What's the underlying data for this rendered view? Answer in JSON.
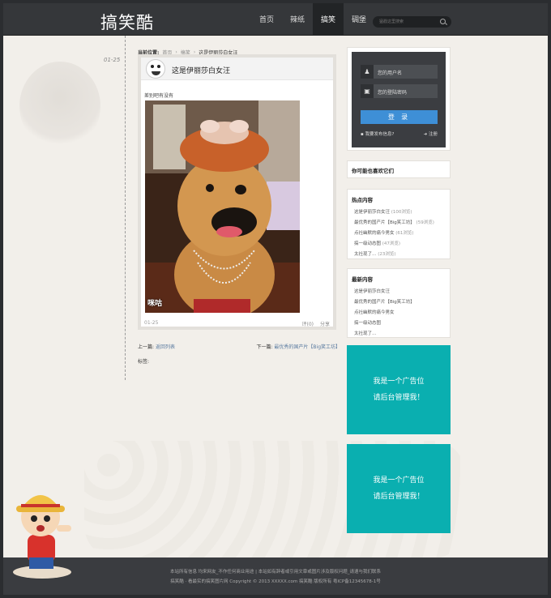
{
  "header": {
    "logo": "搞笑酷",
    "nav": [
      "首页",
      "辣纸",
      "搞笑",
      "碉堡"
    ],
    "active_nav": "搞笑",
    "search_placeholder": "猛戳这里搜索"
  },
  "post": {
    "date": "01-25",
    "breadcrumb": {
      "label": "当前位置:",
      "items": [
        "首页",
        "搞笑",
        "这是伊丽莎白女汪"
      ]
    },
    "title": "这是伊丽莎白女汪",
    "text": "差别吧有没有",
    "watermark": "咪咕 ",
    "footer_date": "01-25",
    "comment": "评(0)",
    "share": "分享",
    "prev_label": "上一篇:",
    "prev_link": "返回列表",
    "next_label": "下一篇:",
    "next_link": "最优秀的国产片【Big笑工坊】",
    "tags_label": "标签:"
  },
  "login": {
    "username": "您的用户名",
    "password": "您的登陆密码",
    "button": "登 录",
    "remember": "我要发布信息?",
    "register": "注册"
  },
  "like_title": "你可能也喜欢它们",
  "hot": {
    "title": "热点内容",
    "items": [
      {
        "text": "这是伊丽莎白女汪",
        "count": "(100浏览)"
      },
      {
        "text": "最优秀的国产片【Big笑工坊】",
        "count": "(59浏览)"
      },
      {
        "text": "点社幽默的痛今男女",
        "count": "(61浏览)"
      },
      {
        "text": "搞一级动态图",
        "count": "(47浏览)"
      },
      {
        "text": "太社现了…",
        "count": "(23浏览)"
      }
    ]
  },
  "newest": {
    "title": "最新内容",
    "items": [
      "这是伊丽莎白女汪",
      "最优秀的国产片【Big笑工坊】",
      "点社幽默的痛今男女",
      "搞一级动态图",
      "太社现了…"
    ]
  },
  "ads": [
    {
      "line1": "我是一个广告位",
      "line2": "请后台管理我！"
    },
    {
      "line1": "我是一个广告位",
      "line2": "请后台管理我！"
    }
  ],
  "footer": {
    "line1": "本站所有信息  均来网友_不作任何商业用途   |   本站如有辞者或引用文章或图片涉及版权问题_请速与我们联系",
    "line2": "搞笑酷 · 看最实的搞笑图片网 Copyright © 2013 XXXXX.com 搞笑酷 版权所有 粤ICP备12345678-1号"
  },
  "colors": {
    "header_bg": "#35373a",
    "accent_blue": "#3e8fd6",
    "ad_teal": "#0aafb0",
    "page_bg": "#f2efea"
  }
}
